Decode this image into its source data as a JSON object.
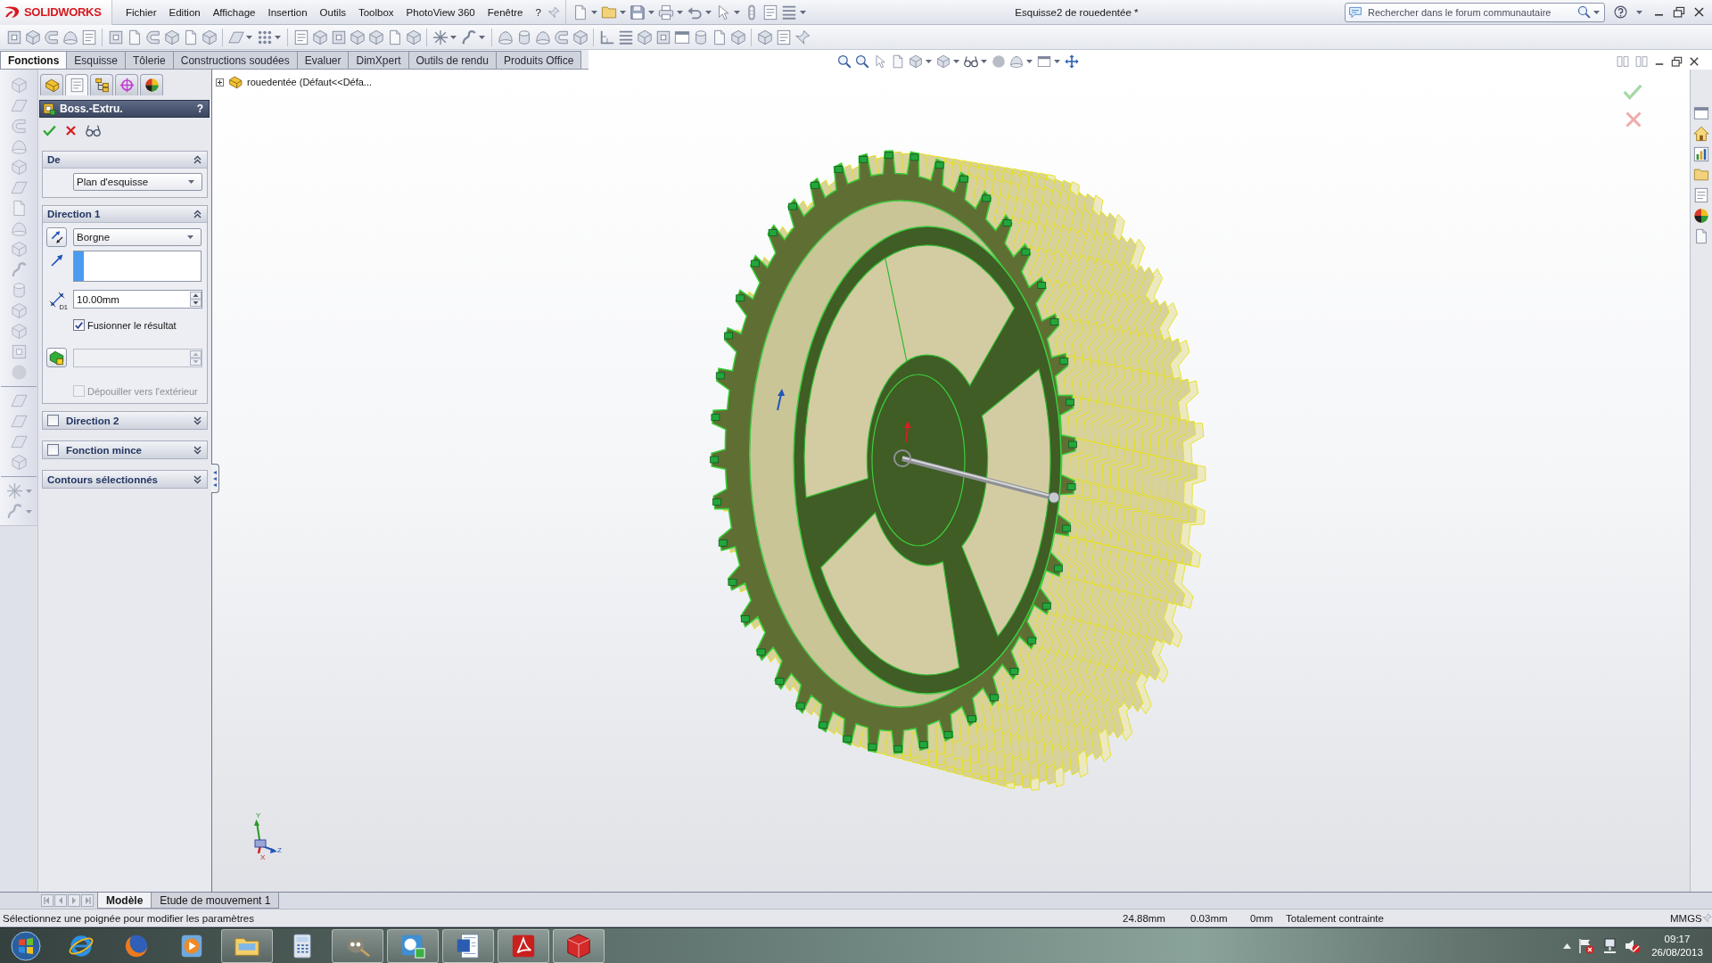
{
  "window": {
    "logo": "SOLIDWORKS",
    "menu": [
      "Fichier",
      "Edition",
      "Affichage",
      "Insertion",
      "Outils",
      "Toolbox",
      "PhotoView 360",
      "Fenêtre",
      "?"
    ],
    "title": "Esquisse2 de rouedentée *",
    "search": {
      "placeholder": "Rechercher dans le forum communautaire"
    }
  },
  "command_tabs": [
    {
      "label": "Fonctions",
      "selected": true
    },
    {
      "label": "Esquisse",
      "selected": false
    },
    {
      "label": "Tôlerie",
      "selected": false
    },
    {
      "label": "Constructions soudées",
      "selected": false
    },
    {
      "label": "Evaluer",
      "selected": false
    },
    {
      "label": "DimXpert",
      "selected": false
    },
    {
      "label": "Outils de rendu",
      "selected": false
    },
    {
      "label": "Produits Office",
      "selected": false
    }
  ],
  "property_manager": {
    "panel_tabs": [
      {
        "selected": false
      },
      {
        "selected": true
      },
      {
        "selected": false
      },
      {
        "selected": false
      },
      {
        "selected": false
      }
    ],
    "title": "Boss.-Extru.",
    "help": "?",
    "sections": [
      {
        "kind": "from",
        "title": "De",
        "expanded": true,
        "dropdown": "Plan d'esquisse"
      },
      {
        "kind": "direction",
        "title": "Direction 1",
        "expanded": true,
        "end_condition": "Borgne",
        "depth_symbol": "D1",
        "depth": "10.00mm",
        "merge": {
          "label": "Fusionner le résultat",
          "checked": true
        },
        "draft": {
          "label": "Dépouiller vers l'extérieur",
          "checked": false,
          "disabled": true
        }
      },
      {
        "kind": "optional",
        "title": "Direction 2",
        "checked": false,
        "expanded": false
      },
      {
        "kind": "optional",
        "title": "Fonction mince",
        "checked": false,
        "expanded": false
      },
      {
        "kind": "plain",
        "title": "Contours sélectionnés",
        "expanded": false
      }
    ]
  },
  "graphics": {
    "tree_item": "rouedentée (Défaut<<Défa...",
    "triad_axes": [
      "Y",
      "Z",
      "X"
    ]
  },
  "bottom_tabs": [
    {
      "label": "Modèle",
      "selected": true
    },
    {
      "label": "Etude de mouvement 1",
      "selected": false
    }
  ],
  "status_bar": {
    "message": "Sélectionnez une poignée pour modifier les paramètres",
    "readouts": [
      "24.88mm",
      "0.03mm",
      "0mm"
    ],
    "state": "Totalement contrainte",
    "units": "MMGS"
  },
  "taskbar": {
    "apps": [
      {
        "running": false
      },
      {
        "running": false
      },
      {
        "running": false
      },
      {
        "running": true
      },
      {
        "running": false
      },
      {
        "running": true
      },
      {
        "running": true
      },
      {
        "running": true
      },
      {
        "running": true
      },
      {
        "running": true
      }
    ],
    "time": "09:17",
    "date": "26/08/2013"
  }
}
